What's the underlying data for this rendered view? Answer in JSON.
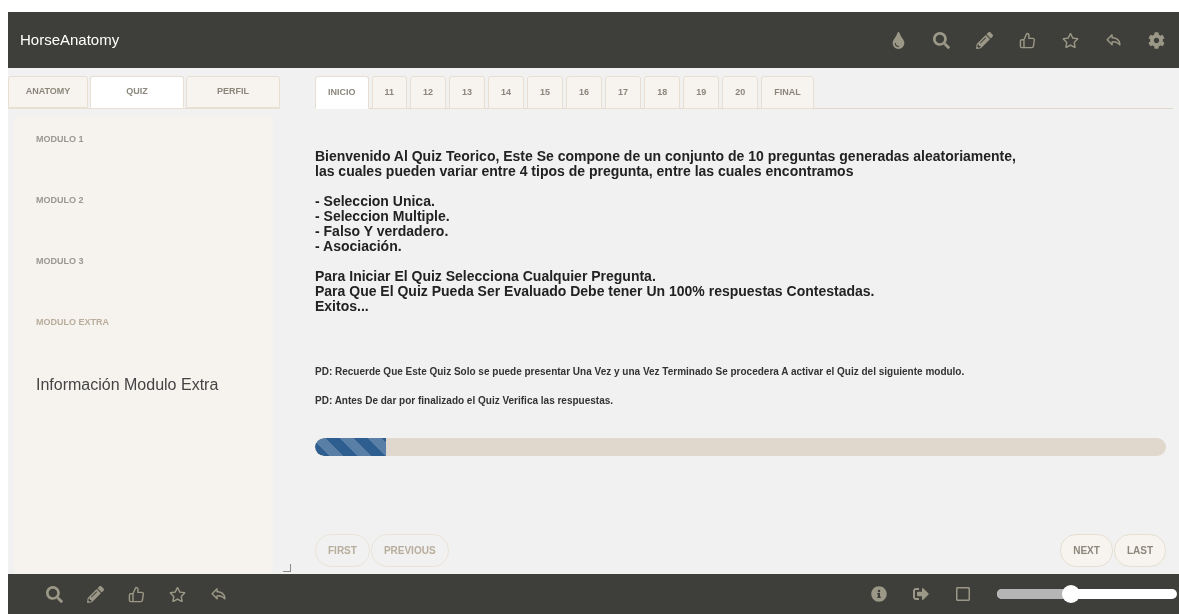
{
  "app_title": "HorseAnatomy",
  "sidebar_tabs": [
    {
      "label": "ANATOMY",
      "selected": false
    },
    {
      "label": "QUIZ",
      "selected": true
    },
    {
      "label": "PERFIL",
      "selected": false
    }
  ],
  "modules": [
    {
      "label": "MODULO 1",
      "disabled": false
    },
    {
      "label": "MODULO 2",
      "disabled": false
    },
    {
      "label": "MODULO 3",
      "disabled": false
    },
    {
      "label": "MODULO EXTRA",
      "disabled": true
    }
  ],
  "sidebar_info": "Información Modulo Extra",
  "question_tabs": [
    {
      "label": "INICIO",
      "selected": true
    },
    {
      "label": "11",
      "selected": false
    },
    {
      "label": "12",
      "selected": false
    },
    {
      "label": "13",
      "selected": false
    },
    {
      "label": "14",
      "selected": false
    },
    {
      "label": "15",
      "selected": false
    },
    {
      "label": "16",
      "selected": false
    },
    {
      "label": "17",
      "selected": false
    },
    {
      "label": "18",
      "selected": false
    },
    {
      "label": "19",
      "selected": false
    },
    {
      "label": "20",
      "selected": false
    },
    {
      "label": "FINAL",
      "selected": false
    }
  ],
  "intro_lines": [
    "Bienvenido Al Quiz Teorico, Este Se compone de un conjunto de 10 preguntas generadas aleatoriamente,",
    "las cuales pueden variar entre 4 tipos de pregunta, entre las cuales encontramos"
  ],
  "question_types": [
    "- Seleccion Unica.",
    "- Seleccion Multiple.",
    "- Falso Y verdadero.",
    "- Asociación."
  ],
  "instructions": [
    "Para Iniciar El Quiz Selecciona Cualquier Pregunta.",
    "Para Que El Quiz Pueda Ser Evaluado Debe tener Un 100% respuestas Contestadas.",
    "Exitos..."
  ],
  "notes": [
    "PD: Recuerde Que Este Quiz Solo se puede presentar Una Vez y una Vez Terminado Se procedera A activar el Quiz del siguiente modulo.",
    "PD: Antes De dar por finalizado el Quiz Verifica las respuestas."
  ],
  "progress": {
    "level": 0.083
  },
  "nav_left": [
    {
      "label": "FIRST",
      "disabled": true
    },
    {
      "label": "PREVIOUS",
      "disabled": true
    }
  ],
  "nav_right": [
    {
      "label": "NEXT",
      "disabled": false
    },
    {
      "label": "LAST",
      "disabled": false
    }
  ],
  "footer_slider": {
    "level": 0.41
  }
}
